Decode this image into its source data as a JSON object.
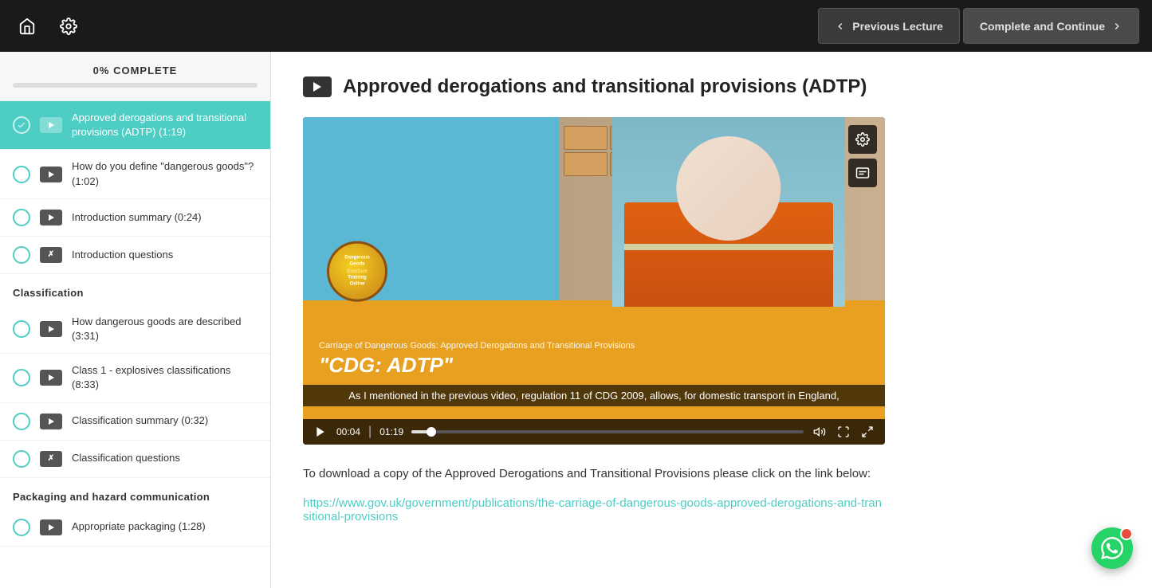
{
  "topNav": {
    "homeIcon": "home",
    "settingsIcon": "settings",
    "prevBtn": "Previous Lecture",
    "completeBtn": "Complete and Continue"
  },
  "sidebar": {
    "progress": {
      "percent": 0,
      "label": "0%",
      "suffix": "COMPLETE"
    },
    "items": [
      {
        "id": "item-adtp",
        "type": "video",
        "label": "Approved derogations and transitional provisions (ADTP) (1:19)",
        "active": true
      },
      {
        "id": "item-dangerous-goods",
        "type": "video",
        "label": "How do you define \"dangerous goods\"? (1:02)",
        "active": false
      },
      {
        "id": "item-intro-summary",
        "type": "video",
        "label": "Introduction summary (0:24)",
        "active": false
      },
      {
        "id": "item-intro-questions",
        "type": "quiz",
        "label": "Introduction questions",
        "active": false
      }
    ],
    "sections": [
      {
        "id": "section-classification",
        "label": "Classification",
        "items": [
          {
            "id": "item-how-described",
            "type": "video",
            "label": "How dangerous goods are described (3:31)"
          },
          {
            "id": "item-class1",
            "type": "video",
            "label": "Class 1 - explosives classifications (8:33)"
          },
          {
            "id": "item-class-summary",
            "type": "video",
            "label": "Classification summary (0:32)"
          },
          {
            "id": "item-class-questions",
            "type": "quiz",
            "label": "Classification questions"
          }
        ]
      },
      {
        "id": "section-packaging",
        "label": "Packaging and hazard communication",
        "items": [
          {
            "id": "item-packaging",
            "type": "video",
            "label": "Appropriate packaging (1:28)"
          }
        ]
      }
    ]
  },
  "content": {
    "lectureIcon": "video",
    "lectureTitle": "Approved derogations and transitional provisions (ADTP)",
    "video": {
      "bottomSubtitle": "Carriage of Dangerous Goods: Approved Derogations and Transitional Provisions",
      "bottomTitle": "\"CDG: ADTP\"",
      "logoText": "Dangerous Goods Training Online",
      "currentTime": "00:04",
      "duration": "01:19",
      "progressPercent": 5,
      "subtitle": "As I mentioned in the previous video, regulation 11 of CDG 2009, allows, for domestic transport in England,"
    },
    "description": "To download a copy of the Approved Derogations and Transitional Provisions please click on the link below:",
    "link": "https://www.gov.uk/government/publications/the-carriage-of-dangerous-goods-approved-derogations-and-transitional-provisions"
  }
}
